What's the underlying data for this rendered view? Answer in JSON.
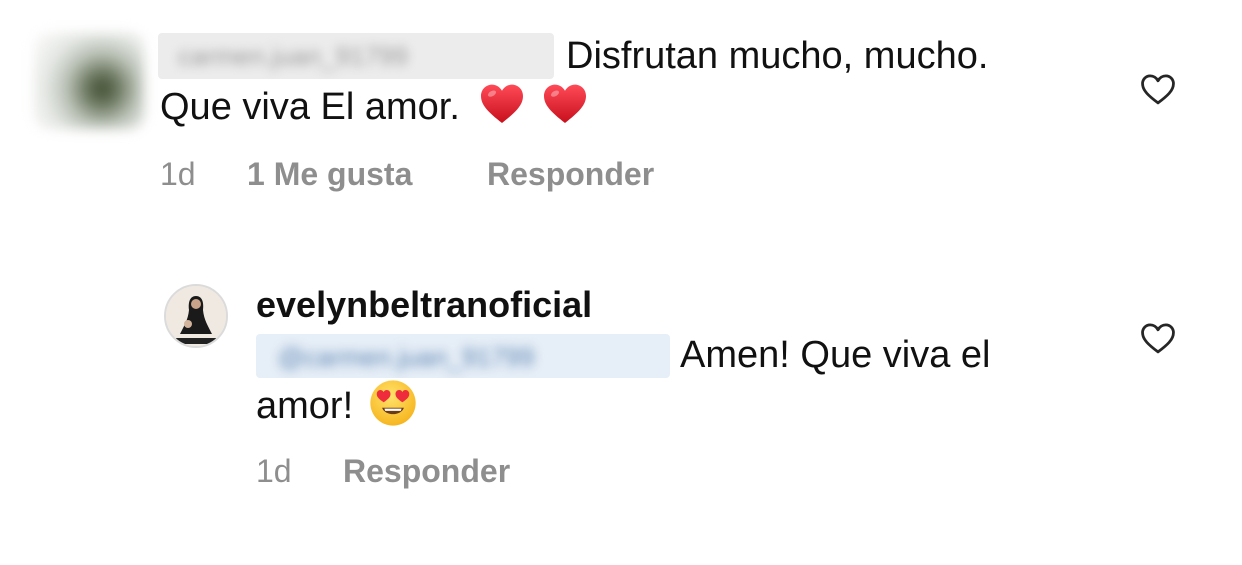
{
  "comments": [
    {
      "username": "carmen.juan_91799",
      "text_part1": "Disfrutan mucho, mucho.",
      "text_part2": "Que viva El amor.",
      "emojis": [
        "red-heart-emoji",
        "red-heart-emoji"
      ],
      "time": "1d",
      "likes": "1 Me gusta",
      "reply_label": "Responder",
      "like_icon": "heart-outline-icon"
    },
    {
      "username": "evelynbeltranoficial",
      "mention": "@carmen.juan_91799",
      "text_part1": "Amen! Que viva el",
      "text_part2": "amor!",
      "emojis": [
        "smiling-face-with-heart-eyes-emoji"
      ],
      "time": "1d",
      "reply_label": "Responder",
      "like_icon": "heart-outline-icon"
    }
  ],
  "colors": {
    "text": "#111111",
    "meta": "#8e8e8e",
    "heart_red": "#e11b2a",
    "background": "#ffffff"
  }
}
